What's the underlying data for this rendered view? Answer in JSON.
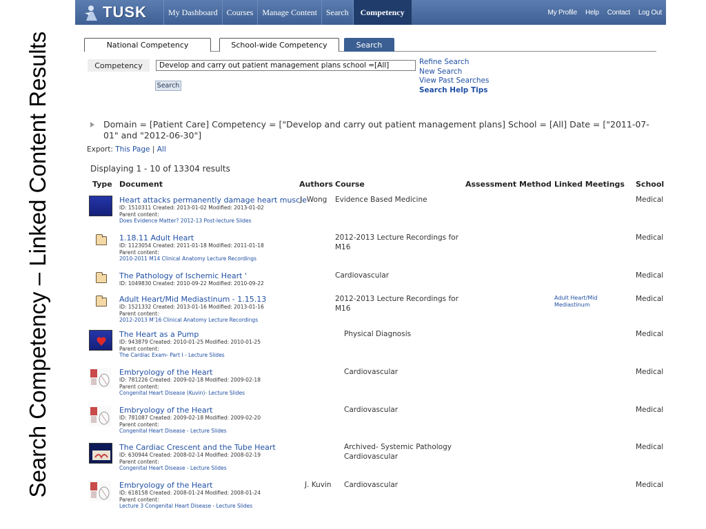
{
  "slide": {
    "title": "Search Competency – Linked Content Results"
  },
  "nav": {
    "logo": "TUSK",
    "tabs": [
      "My Dashboard",
      "Courses",
      "Manage Content",
      "Search",
      "Competency"
    ],
    "right_links": [
      "My Profile",
      "Help",
      "Contact",
      "Log Out"
    ]
  },
  "subtabs": [
    "National Competency",
    "School-wide Competency",
    "Search"
  ],
  "search": {
    "label": "Competency",
    "value": "Develop and carry out patient management plans  school =[All]",
    "button": "Search"
  },
  "side_links": [
    "Refine Search",
    "New Search",
    "View Past Searches",
    "Search Help Tips"
  ],
  "criteria": "Domain = [Patient Care] Competency = [\"Develop and carry out patient management plans] School = [All] Date = [\"2011-07-01\" and \"2012-06-30\"]",
  "export": {
    "label": "Export:",
    "this_page": "This Page",
    "sep": "|",
    "all": "All"
  },
  "displaying": "Displaying 1 - 10 of 13304 results",
  "columns": [
    "Type",
    "Document",
    "Authors",
    "Course",
    "Assessment Method",
    "Linked Meetings",
    "School"
  ],
  "rows": [
    {
      "type": "slides-blue",
      "title": "Heart attacks permanently damage heart muscle",
      "meta": "ID: 1510311   Created: 2013-01-02   Modified: 2013-01-02",
      "parent_label": "Parent content:",
      "parent": "Does Evidence Matter? 2012-13 Post-lecture Slides",
      "author": "J. Wong",
      "course": "Evidence Based Medicine",
      "meeting": "",
      "school": "Medical"
    },
    {
      "type": "folder",
      "title": "1.18.11 Adult Heart",
      "meta": "ID: 1123054   Created: 2011-01-18   Modified: 2011-01-18",
      "parent_label": "Parent content:",
      "parent": "2010-2011 M14 Clinical Anatomy Lecture Recordings",
      "author": "",
      "course": "2012-2013 Lecture Recordings for M16",
      "meeting": "",
      "school": "Medical"
    },
    {
      "type": "folder",
      "title": "The Pathology of Ischemic Heart '",
      "meta": "ID: 1049830   Created: 2010-09-22   Modified: 2010-09-22",
      "parent_label": "",
      "parent": "",
      "author": "",
      "course": "Cardiovascular",
      "meeting": "",
      "school": "Medical"
    },
    {
      "type": "folder",
      "title": "Adult Heart/Mid Mediastinum - 1.15.13",
      "meta": "ID: 1521332   Created: 2013-01-16   Modified: 2013-01-16",
      "parent_label": "Parent content:",
      "parent": "2012-2013 M'16 Clinical Anatomy Lecture Recordings",
      "author": "",
      "course": "2012-2013 Lecture Recordings for M16",
      "meeting": "Adult Heart/Mid Mediastinum",
      "school": "Medical"
    },
    {
      "type": "slides-heart",
      "title": "The Heart as a Pump",
      "meta": "ID: 943879   Created: 2010-01-25   Modified: 2010-01-25",
      "parent_label": "Parent content:",
      "parent": "The Cardiac Exam- Part I - Lecture Slides",
      "author": "",
      "course": "Physical Diagnosis",
      "meeting": "",
      "school": "Medical"
    },
    {
      "type": "slides-diagram",
      "title": "Embryology of the Heart",
      "meta": "ID: 781226   Created: 2009-02-18   Modified: 2009-02-18",
      "parent_label": "Parent content:",
      "parent": "Congenital Heart Disease (Kuvin)- Lecture Slides",
      "author": "",
      "course": "Cardiovascular",
      "meeting": "",
      "school": "Medical"
    },
    {
      "type": "slides-diagram",
      "title": "Embryology of the Heart",
      "meta": "ID: 781087   Created: 2009-02-18   Modified: 2009-02-20",
      "parent_label": "Parent content:",
      "parent": "Congenital Heart Disease - Lecture Slides",
      "author": "",
      "course": "Cardiovascular",
      "meeting": "",
      "school": "Medical"
    },
    {
      "type": "slides-navy",
      "title": "The Cardiac Crescent and the Tube Heart",
      "meta": "ID: 630944   Created: 2008-02-14   Modified: 2008-02-19",
      "parent_label": "Parent content:",
      "parent": "Congenital Heart Disease - Lecture Slides",
      "author": "",
      "course": "Archived- Systemic Pathology Cardiovascular",
      "meeting": "",
      "school": "Medical"
    },
    {
      "type": "slides-diagram",
      "title": "Embryology of the Heart",
      "meta": "ID: 618158   Created: 2008-01-24   Modified: 2008-01-24",
      "parent_label": "Parent content:",
      "parent": "Lecture 3 Congenital Heart Disease - Lecture Slides",
      "author": "J. Kuvin",
      "course": "Cardiovascular",
      "meeting": "",
      "school": "Medical"
    }
  ],
  "colors": {
    "nav": "#4a6ca2",
    "active_tab": "#1f3c6b",
    "link": "#1f4fa3"
  }
}
